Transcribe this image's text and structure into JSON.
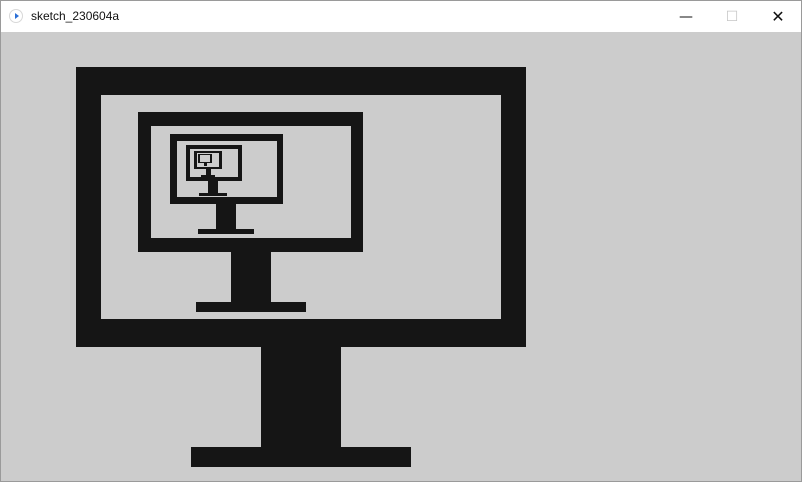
{
  "window": {
    "title": "sketch_230604a",
    "minimize_glyph": "—",
    "maximize_glyph": "☐",
    "close_glyph": "✕",
    "icon": "processing-app-icon"
  },
  "canvas": {
    "background": "#cccccc",
    "fill": "#151515",
    "description_icon": "recursive-monitor-icon"
  }
}
